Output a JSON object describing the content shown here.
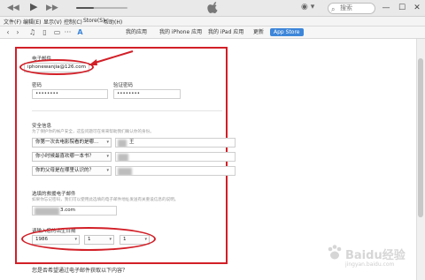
{
  "window": {
    "minimize": "—",
    "maximize": "☐",
    "close": "✕"
  },
  "player": {
    "prev": "◀◀",
    "play": "▶",
    "next": "▶▶",
    "progress": 0.35
  },
  "account": {
    "icon": "person-icon",
    "arrow": "▾"
  },
  "search": {
    "placeholder": "搜索"
  },
  "menu": [
    "文件(F)",
    "编辑(E)",
    "显示(V)",
    "控制(C)",
    "Store(S)",
    "帮助(H)"
  ],
  "toolbar": {
    "back": "‹",
    "forward": "›",
    "tabs": [
      "我的应用",
      "我的 iPhone 应用",
      "我的 iPad 应用",
      "更新",
      "App Store"
    ],
    "active_tab": "App Store",
    "active_color": "#3d86d9"
  },
  "form": {
    "email_label": "电子邮件",
    "email_value": "iphonewanjia@126.com",
    "password_label": "密码",
    "password_value": "••••••••",
    "verify_label": "验证密码",
    "verify_value": "••••••••",
    "security_label": "安全信息",
    "security_hint": "为了保护你的帐户安全，这些问题可在将来帮助我们确认你的身份。",
    "questions": [
      {
        "question": "你第一次去电影院看的是哪…",
        "answer": "王"
      },
      {
        "question": "你小时候最喜欢哪一本书？",
        "answer": ""
      },
      {
        "question": "你的父母是在哪里认识的？",
        "answer": ""
      }
    ],
    "rescue_label": "选填的救援电子邮件",
    "rescue_hint": "如果你忘记密码，我们可以使用此选填的电子邮件地址发送有关重设信息的说明。",
    "rescue_value": "3.com",
    "birthday_label": "请输入您的出生日期",
    "birth_year": "1986",
    "birth_month": "1",
    "birth_day": "1",
    "bottom_question": "您是否希望通过电子邮件获取以下内容？",
    "highlight_color": "#d21f27"
  },
  "watermark": {
    "text": "Baidu经验",
    "sub": "jingyan.baidu.com"
  }
}
